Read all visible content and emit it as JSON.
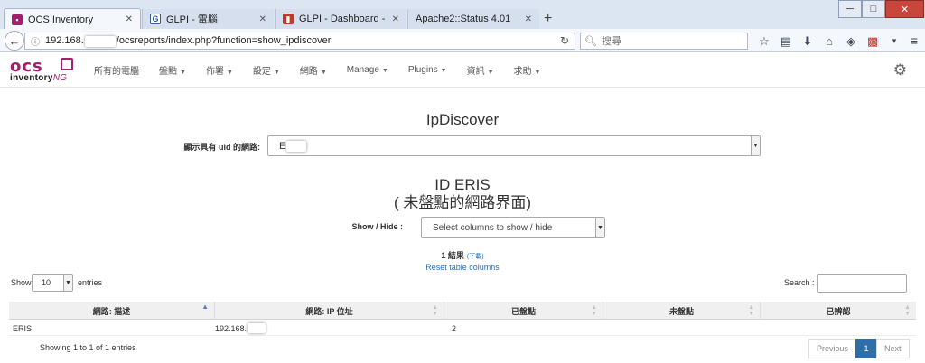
{
  "browser": {
    "tabs": [
      {
        "label": "OCS Inventory",
        "active": true,
        "favicon_color": "#a0216b"
      },
      {
        "label": "GLPI - 電腦",
        "active": false,
        "favicon_color": "#2c5fa0"
      },
      {
        "label": "GLPI - Dashboard - Home",
        "active": false,
        "favicon_color": "#c0392b"
      },
      {
        "label": "Apache2::Status 4.01",
        "active": false,
        "favicon_color": ""
      }
    ],
    "url_prefix": "192.168.",
    "url_suffix": "/ocsreports/index.php?function=show_ipdiscover",
    "search_placeholder": "搜尋"
  },
  "app": {
    "menu": [
      {
        "label": "所有的電腦",
        "dropdown": false
      },
      {
        "label": "盤點",
        "dropdown": true
      },
      {
        "label": "佈署",
        "dropdown": true
      },
      {
        "label": "設定",
        "dropdown": true
      },
      {
        "label": "網路",
        "dropdown": true
      },
      {
        "label": "Manage",
        "dropdown": true
      },
      {
        "label": "Plugins",
        "dropdown": true
      },
      {
        "label": "資訊",
        "dropdown": true
      },
      {
        "label": "求助",
        "dropdown": true
      }
    ],
    "brand_color": "#a0216b"
  },
  "main": {
    "title": "IpDiscover",
    "uid_label": "顯示具有 uid 的網路:",
    "uid_value": "E",
    "section_title": "ID ERIS",
    "section_subtitle": "( 未盤點的網路界面)",
    "showhide_label": "Show / Hide :",
    "showhide_value": "Select columns to show / hide",
    "results_count": "1 結果",
    "results_download": "(下載)",
    "reset_link": "Reset table columns",
    "length_label": "Show",
    "length_value": "10",
    "length_suffix": "entries",
    "search_label": "Search :",
    "columns": [
      "網路: 描述",
      "網路: IP 位址",
      "已盤點",
      "未盤點",
      "已辨認"
    ],
    "rows": [
      {
        "desc": "ERIS",
        "ip": "192.168.",
        "inventoried": "2",
        "not_inventoried": "",
        "identified": ""
      }
    ],
    "info": "Showing 1 to 1 of 1 entries",
    "pagination": {
      "previous": "Previous",
      "current": "1",
      "next": "Next"
    },
    "accent_color": "#2f6ea6",
    "link_color": "#2a6ebb"
  }
}
